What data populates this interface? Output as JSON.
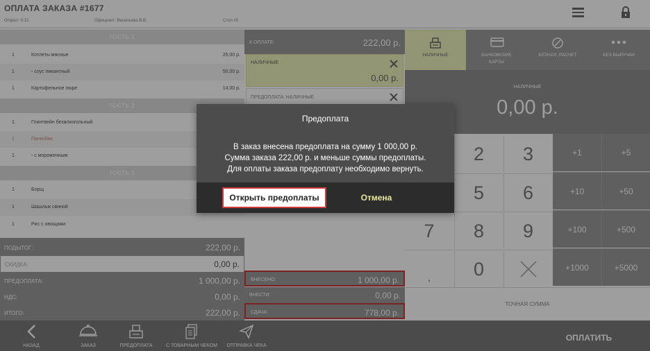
{
  "header": {
    "title": "ОПЛАТА ЗАКАЗА #1677",
    "opened": "Открыт: 9:12",
    "waiter": "Официант: Васильева В.В.",
    "table": "Стол #5"
  },
  "order": {
    "guests": [
      {
        "label": "ГОСТЬ 1",
        "items": [
          {
            "qty": "1",
            "name": "Котлеты мясные",
            "price": "25,00 р."
          },
          {
            "qty": "1",
            "name": "- соус пикантный",
            "price": "50,00 р."
          },
          {
            "qty": "1",
            "name": "Картофельное пюре",
            "price": "14,00 р."
          }
        ]
      },
      {
        "label": "ГОСТЬ 2",
        "items": [
          {
            "qty": "1",
            "name": "Глинтвейн безалкогольный",
            "price": ""
          },
          {
            "qty": "1",
            "name": "Панкейки",
            "price": ""
          },
          {
            "qty": "1",
            "name": "- с мороженным",
            "price": ""
          }
        ]
      },
      {
        "label": "ГОСТЬ 3",
        "items": [
          {
            "qty": "1",
            "name": "Борщ",
            "price": ""
          },
          {
            "qty": "1",
            "name": "Шашлык свиной",
            "price": ""
          },
          {
            "qty": "1",
            "name": "Рис с овощами",
            "price": ""
          }
        ]
      }
    ]
  },
  "totals": {
    "subtotal_label": "ПОДЫТОГ:",
    "subtotal": "222,00 р.",
    "discount_label": "СКИДКА:",
    "discount": "0,00 р.",
    "prepaid_label": "ПРЕДОПЛАТА:",
    "prepaid": "1 000,00 р.",
    "vat_label": "НДС:",
    "vat": "0,00 р.",
    "total_label": "ИТОГО:",
    "total": "222,00 р."
  },
  "payment": {
    "due_label": "К ОПЛАТЕ:",
    "due": "222,00 р.",
    "cash_label": "НАЛИЧНЫЕ",
    "cash": "0,00 р.",
    "prepaid_line_label": "ПРЕДОПЛАТА: НАЛИЧНЫЕ",
    "deposited_label": "ВНЕСЕНО:",
    "deposited": "1 000,00 р.",
    "to_deposit_label": "ВНЕСТИ:",
    "to_deposit": "0,00 р.",
    "change_label": "СДАЧА:",
    "change": "778,00 р."
  },
  "methods": {
    "cash": "НАЛИЧНЫЕ",
    "card_line1": "БАНКОВСКИЕ",
    "card_line2": "КАРТЫ",
    "noncash": "БЕЗНАЛ. РАСЧЕТ",
    "no_revenue": "БЕЗ ВЫРУЧКИ"
  },
  "display": {
    "label": "НАЛИЧНЫЕ",
    "value": "0,00 р."
  },
  "keypad": {
    "k2": "2",
    "k3": "3",
    "k5": "5",
    "k6": "6",
    "k7": "7",
    "k8": "8",
    "k9": "9",
    "k0": "0",
    "k_sep": ",",
    "plus1": "+1",
    "plus5": "+5",
    "plus10": "+10",
    "plus50": "+50",
    "plus100": "+100",
    "plus500": "+500",
    "plus1000": "+1000",
    "plus5000": "+5000",
    "exact": "ТОЧНАЯ СУММА"
  },
  "bottom": {
    "back": "НАЗАД",
    "order": "ЗАКАЗ",
    "prepay": "ПРЕДОПЛАТА",
    "with_receipt": "С ТОВАРНЫМ ЧЕКОМ",
    "send_receipt": "ОТПРАВКА ЧЕКА",
    "pay": "ОПЛАТИТЬ"
  },
  "dialog": {
    "title": "Предоплата",
    "line1": "В заказ внесена предоплата на сумму 1 000,00 р.",
    "line2": "Сумма заказа 222,00 р. и меньше суммы предоплаты.",
    "line3": "Для оплаты заказа предоплату необходимо вернуть.",
    "open_btn": "Открыть предоплаты",
    "cancel_btn": "Отмена"
  },
  "colors": {
    "accent_yellow": "#eef2bc",
    "highlight_red": "#d33a3a",
    "panel_gray": "#999999"
  }
}
